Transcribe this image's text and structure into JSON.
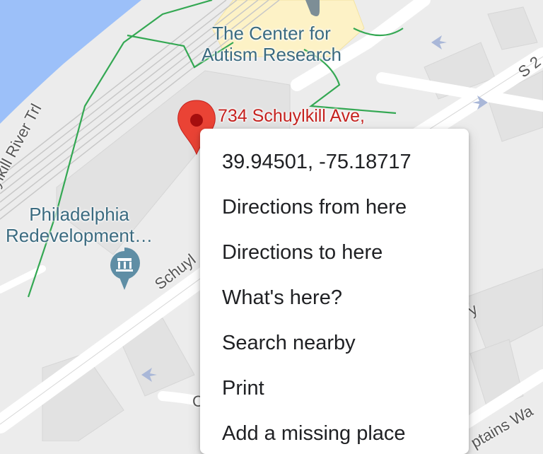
{
  "map": {
    "poi": {
      "autism_center": {
        "line1": "The Center for",
        "line2": "Autism Research"
      },
      "philadelphia_redevelopment": {
        "line1": "Philadelphia",
        "line2": "Redevelopment…"
      }
    },
    "streets": {
      "river_trail": "ylkill River Trl",
      "schuylkill": "Schuyl",
      "s22": "S 2",
      "captains_way": "ptains Wa",
      "partial_y": "y",
      "partial_c": "C"
    },
    "pin": {
      "label": "734 Schuylkill Ave,",
      "color": "#ea4335"
    },
    "colors": {
      "water": "#9cc0f9",
      "land": "#ececec",
      "trail": "#34a853",
      "accent_label": "#3b6b80"
    }
  },
  "context_menu": {
    "items": [
      {
        "label": "39.94501, -75.18717"
      },
      {
        "label": "Directions from here"
      },
      {
        "label": "Directions to here"
      },
      {
        "label": "What's here?"
      },
      {
        "label": "Search nearby"
      },
      {
        "label": "Print"
      },
      {
        "label": "Add a missing place"
      }
    ]
  }
}
